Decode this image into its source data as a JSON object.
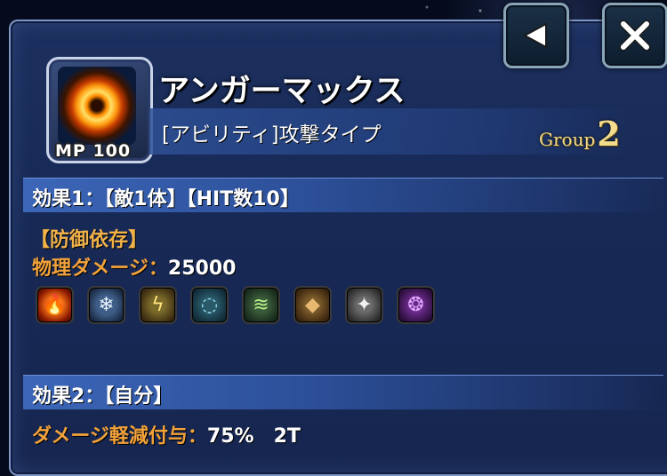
{
  "skill": {
    "name": "アンガーマックス",
    "type": "[アビリティ]攻撃タイプ",
    "mp_cost": "MP 100",
    "group_label": "Group",
    "group_number": "2"
  },
  "effect1": {
    "header": "効果1：【敵1体】【HIT数10】",
    "condition": "【防御依存】",
    "stat_label": "物理ダメージ：",
    "stat_value": "25000",
    "elements": [
      {
        "name": "fire-element-icon",
        "glyph": "🔥"
      },
      {
        "name": "ice-element-icon",
        "glyph": "❄"
      },
      {
        "name": "thunder-element-icon",
        "glyph": "ϟ"
      },
      {
        "name": "water-element-icon",
        "glyph": "◌"
      },
      {
        "name": "wind-element-icon",
        "glyph": "≋"
      },
      {
        "name": "earth-element-icon",
        "glyph": "◆"
      },
      {
        "name": "light-element-icon",
        "glyph": "✦"
      },
      {
        "name": "dark-element-icon",
        "glyph": "❂"
      }
    ]
  },
  "effect2": {
    "header": "効果2：【自分】",
    "stat_label": "ダメージ軽減付与：",
    "stat_value": "75%　2T"
  },
  "buttons": {
    "back_icon": "triangle-left",
    "close_icon": "x-mark"
  }
}
